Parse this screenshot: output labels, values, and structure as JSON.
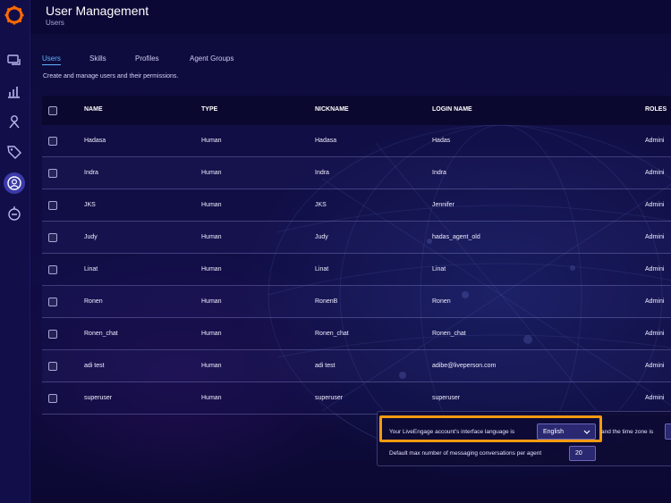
{
  "header": {
    "title": "User Management",
    "subtitle": "Users"
  },
  "tabs": [
    {
      "label": "Users",
      "active": true
    },
    {
      "label": "Skills",
      "active": false
    },
    {
      "label": "Profiles",
      "active": false
    },
    {
      "label": "Agent Groups",
      "active": false
    }
  ],
  "tab_description": "Create and manage users and their permissions.",
  "table": {
    "columns": [
      "NAME",
      "TYPE",
      "NICKNAME",
      "LOGIN NAME",
      "ROLES"
    ],
    "rows": [
      {
        "name": "Hadasa",
        "type": "Human",
        "nickname": "Hadasa",
        "login": "Hadas",
        "roles": "Admini"
      },
      {
        "name": "Indra",
        "type": "Human",
        "nickname": "Indra",
        "login": "Indra",
        "roles": "Admini"
      },
      {
        "name": "JKS",
        "type": "Human",
        "nickname": "JKS",
        "login": "Jennifer",
        "roles": "Admini"
      },
      {
        "name": "Judy",
        "type": "Human",
        "nickname": "Judy",
        "login": "hadas_agent_old",
        "roles": "Admini"
      },
      {
        "name": "Linat",
        "type": "Human",
        "nickname": "Linat",
        "login": "Linat",
        "roles": "Admini"
      },
      {
        "name": "Ronen",
        "type": "Human",
        "nickname": "RonenB",
        "login": "Ronen",
        "roles": "Admini"
      },
      {
        "name": "Ronen_chat",
        "type": "Human",
        "nickname": "Ronen_chat",
        "login": "Ronen_chat",
        "roles": "Admini"
      },
      {
        "name": "adi test",
        "type": "Human",
        "nickname": "adi test",
        "login": "adibe@liveperson.com",
        "roles": "Admini"
      },
      {
        "name": "superuser",
        "type": "Human",
        "nickname": "superuser",
        "login": "superuser",
        "roles": "Admini"
      }
    ]
  },
  "settings": {
    "language_label": "Your LiveEngage account's interface language is",
    "language_value": "English",
    "timezone_label": "and the time zone is",
    "max_conversations_label": "Default max number of messaging conversations per agent",
    "max_conversations_value": "20"
  },
  "sidebar": {
    "icons": [
      "conversations-icon",
      "analytics-icon",
      "agent-icon",
      "tag-icon",
      "users-icon",
      "campaign-icon"
    ],
    "active": "users-icon"
  },
  "colors": {
    "background": "#0d0a3a",
    "accent_tab": "#5fb4ff",
    "highlight": "#f59a11",
    "logo": "#ff6a00"
  }
}
